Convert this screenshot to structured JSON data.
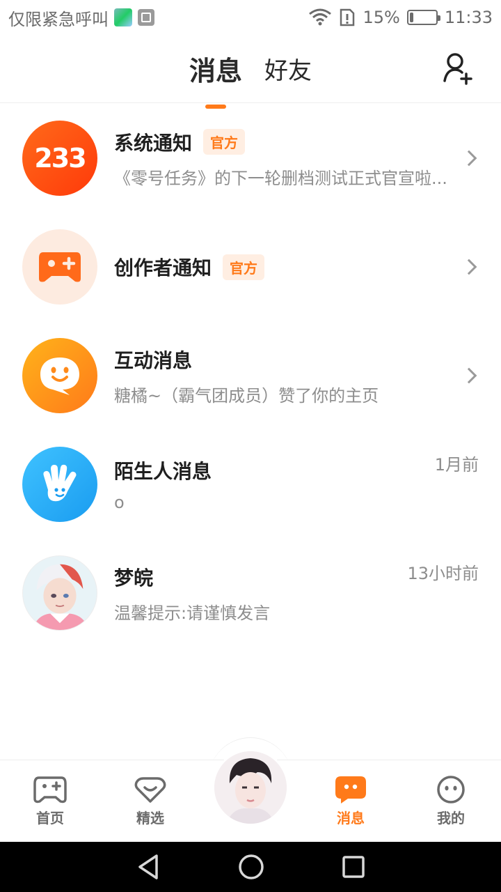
{
  "status_bar": {
    "carrier": "仅限紧急呼叫",
    "battery": "15%",
    "battery_level": 0.15,
    "time": "11:33"
  },
  "header": {
    "tabs": [
      {
        "label": "消息",
        "active": true
      },
      {
        "label": "好友",
        "active": false
      }
    ],
    "add_friend_icon": "add-person-icon"
  },
  "messages": [
    {
      "title": "系统通知",
      "badge": "官方",
      "subtitle": "《零号任务》的下一轮删档测试正式官宣啦...",
      "avatar_text": "233",
      "trailing": "chevron"
    },
    {
      "title": "创作者通知",
      "badge": "官方",
      "subtitle": "",
      "trailing": "chevron"
    },
    {
      "title": "互动消息",
      "subtitle": "糖橘~（霸气团成员）赞了你的主页",
      "trailing": "chevron"
    },
    {
      "title": "陌生人消息",
      "subtitle": "o",
      "time": "1月前"
    },
    {
      "title": "梦皖",
      "subtitle": "温馨提示:请谨慎发言",
      "time": "13小时前"
    }
  ],
  "bottom_nav": [
    {
      "label": "首页",
      "icon": "gamepad-icon",
      "active": false
    },
    {
      "label": "精选",
      "icon": "heart-chat-icon",
      "active": false
    },
    {
      "label": "消息",
      "icon": "message-icon",
      "active": true
    },
    {
      "label": "我的",
      "icon": "smiley-icon",
      "active": false
    }
  ],
  "colors": {
    "accent": "#ff7a1a",
    "badge_bg": "#ffeee2",
    "subtitle": "#8d8d8d"
  }
}
